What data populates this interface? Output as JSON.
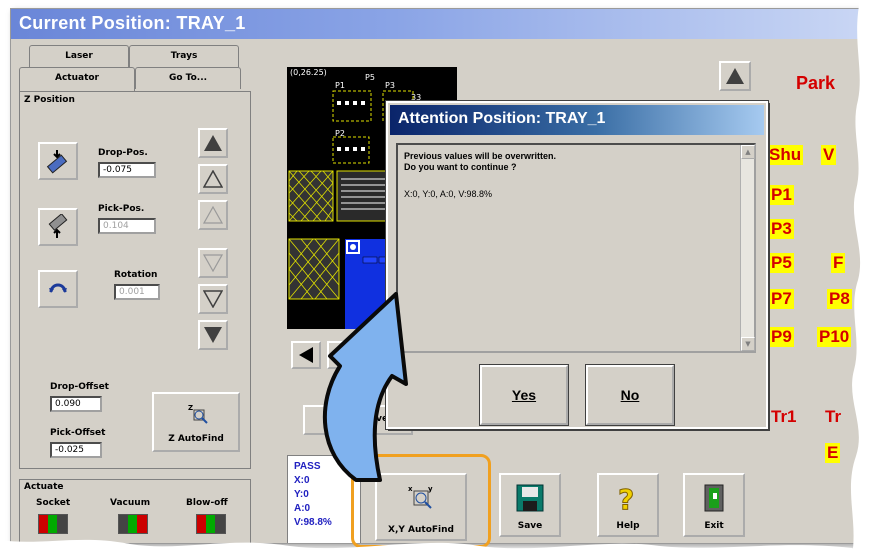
{
  "window": {
    "title": "Current Position: TRAY_1"
  },
  "tabs": {
    "laser": "Laser",
    "trays": "Trays",
    "actuator": "Actuator",
    "goto": "Go To..."
  },
  "z_position": {
    "heading": "Z Position",
    "drop_pos_label": "Drop-Pos.",
    "drop_pos_value": "-0.075",
    "pick_pos_label": "Pick-Pos.",
    "pick_pos_value": "0.104",
    "rotation_label": "Rotation",
    "rotation_value": "0.001"
  },
  "offsets": {
    "drop_offset_label": "Drop-Offset",
    "drop_offset_value": "0.090",
    "pick_offset_label": "Pick-Offset",
    "pick_offset_value": "-0.025",
    "z_autofind_label": "Z AutoFind"
  },
  "actuate": {
    "heading": "Actuate",
    "socket": "Socket",
    "vacuum": "Vacuum",
    "blowoff": "Blow-off"
  },
  "canvas": {
    "coords": "(0,26.25)",
    "p1": "P1",
    "p2": "P2",
    "p3": "P3",
    "p5": "P5",
    "p33": "33"
  },
  "status": {
    "line1": "PASS",
    "line2": "X:0",
    "line3": "Y:0",
    "line4": "A:0",
    "line5": "V:98.8%"
  },
  "buttons": {
    "move_partial": "Move",
    "xy_autofind": "X,Y AutoFind",
    "save": "Save",
    "help": "Help",
    "exit": "Exit"
  },
  "right_panel": {
    "park": "Park",
    "labels": [
      "Shu",
      "V",
      "P1",
      "P3",
      "P5",
      "F",
      "P7",
      "P8",
      "P9",
      "P10",
      "Tr1",
      "Tr",
      "E"
    ]
  },
  "dialog": {
    "title": "Attention  Position: TRAY_1",
    "line1": "Previous values will be overwritten.",
    "line2": "Do you want to continue ?",
    "line3": "X:0, Y:0, A:0, V:98.8%",
    "yes": "Yes",
    "no": "No"
  },
  "colors": {
    "arrow": "#7fb2ee",
    "highlight": "#f0a020",
    "label_red": "#d40000",
    "label_yellow": "#ffff00",
    "status_blue": "#2020c0"
  }
}
